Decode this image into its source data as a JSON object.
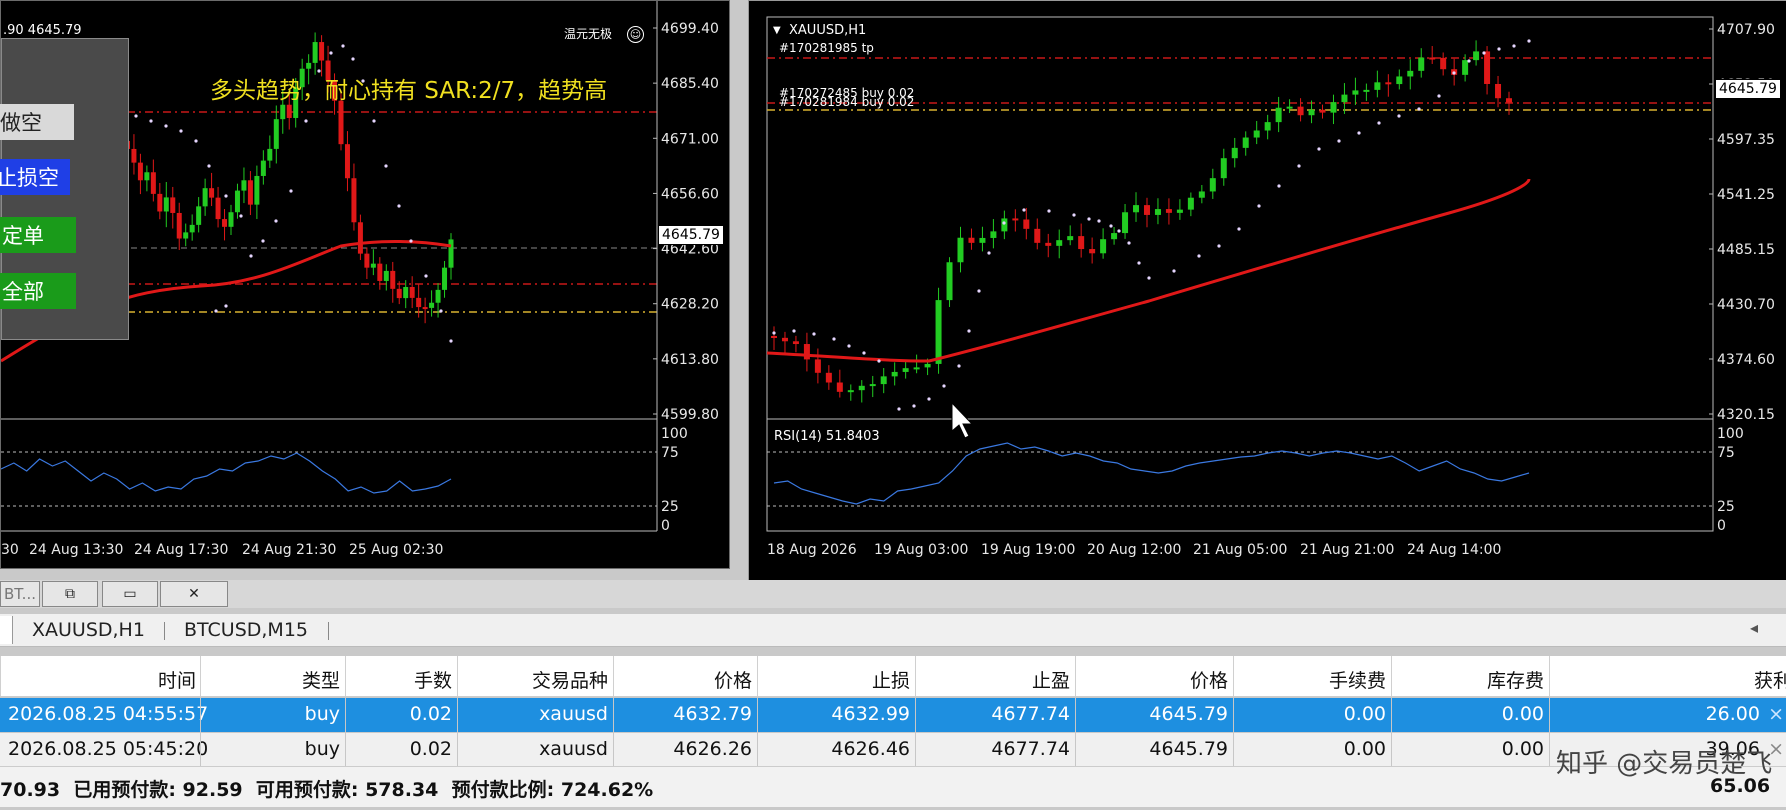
{
  "left_chart": {
    "header_text": ".90 4645.79",
    "badge_text": "温元无极",
    "trend_text": "多头趋势，耐心持有 SAR:2/7，趋势高",
    "current_price": "4645.79",
    "price_labels": [
      "4699.40",
      "4685.40",
      "4671.00",
      "4656.60",
      "4642.60",
      "4628.20",
      "4613.80",
      "4599.80"
    ],
    "rsi_labels": [
      "100",
      "75",
      "25",
      "0"
    ],
    "time_labels": [
      "30",
      "24 Aug 13:30",
      "24 Aug 17:30",
      "24 Aug 21:30",
      "25 Aug 02:30"
    ],
    "panel_buttons": [
      {
        "label": "做空",
        "color": "#d9d9d9"
      },
      {
        "label": "止损空",
        "color": "#1f3fe6"
      },
      {
        "label": "定单",
        "color": "#1a9b1a"
      },
      {
        "label": "全部",
        "color": "#1a9b1a"
      }
    ]
  },
  "right_chart": {
    "title": "XAUUSD,H1",
    "order_tp_label": "#170281985 tp",
    "order_buy_label_1": "#170272485 buy 0.02",
    "order_buy_label_2": "#170281984 buy 0.02",
    "current_price": "4645.79",
    "price_labels": [
      "4707.90",
      "4652.50",
      "4597.35",
      "4541.25",
      "4485.15",
      "4430.70",
      "4374.60",
      "4320.15"
    ],
    "rsi_title": "RSI(14) 51.8403",
    "rsi_labels": [
      "100",
      "75",
      "25",
      "0"
    ],
    "time_labels": [
      "18 Aug 2026",
      "19 Aug 03:00",
      "19 Aug 19:00",
      "20 Aug 12:00",
      "21 Aug 05:00",
      "21 Aug 21:00",
      "24 Aug 14:00"
    ]
  },
  "mdi": {
    "tab_label": "BT...",
    "restore_icon": "restore-icon",
    "maximize_icon": "maximize-icon",
    "close_icon": "close-icon"
  },
  "chart_tabs": [
    {
      "label": "XAUUSD,H1"
    },
    {
      "label": "BTCUSD,M15"
    }
  ],
  "scroll_left_icon": "◂",
  "table": {
    "headers": [
      "时间",
      "类型",
      "手数",
      "交易品种",
      "价格",
      "止损",
      "止盈",
      "价格",
      "手续费",
      "库存费",
      "获利"
    ],
    "rows": [
      {
        "time": "2026.08.25 04:55:57",
        "type": "buy",
        "volume": "0.02",
        "symbol": "xauusd",
        "open_price": "4632.79",
        "sl": "4632.99",
        "tp": "4677.74",
        "price": "4645.79",
        "commission": "0.00",
        "swap": "0.00",
        "profit": "26.00",
        "selected": true
      },
      {
        "time": "2026.08.25 05:45:20",
        "type": "buy",
        "volume": "0.02",
        "symbol": "xauusd",
        "open_price": "4626.26",
        "sl": "4626.46",
        "tp": "4677.74",
        "price": "4645.79",
        "commission": "0.00",
        "swap": "0.00",
        "profit": "39.06",
        "selected": false
      }
    ],
    "close_glyph": "×"
  },
  "balance": {
    "summary": "70.93  已用预付款: 92.59  可用预付款: 578.34  预付款比例: 724.62%",
    "total_profit": "65.06"
  },
  "watermark": "知乎 @交易员楚飞",
  "colors": {
    "bull": "#22cc22",
    "bear": "#e01818",
    "ma": "#e01818",
    "sar": "#e6d6ff",
    "rsi": "#3a78e0",
    "selected_row": "#1e8fe0",
    "trend_text": "#f0e020"
  }
}
